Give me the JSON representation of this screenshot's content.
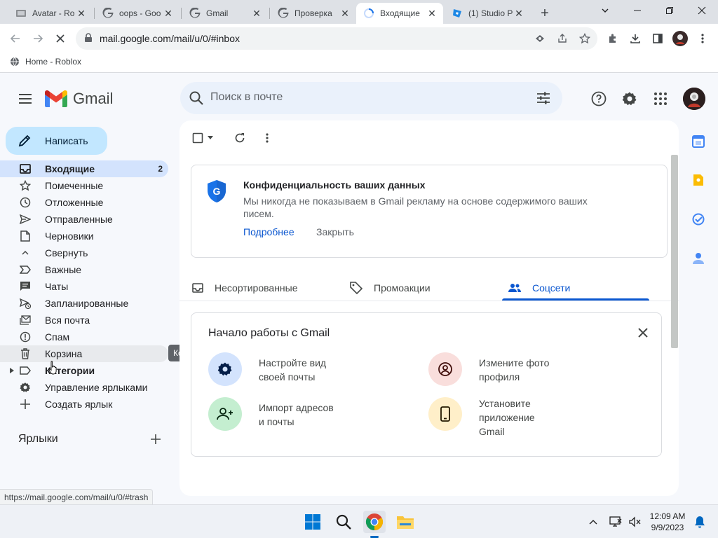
{
  "browser": {
    "tabs": [
      {
        "title": "Avatar - Ro",
        "icon": "roblox-page-icon",
        "active": false
      },
      {
        "title": "oops - Goo",
        "icon": "google-icon",
        "active": false
      },
      {
        "title": "Gmail",
        "icon": "google-icon",
        "active": false
      },
      {
        "title": "Проверка",
        "icon": "google-icon",
        "active": false
      },
      {
        "title": "Входящие",
        "icon": "loading-icon",
        "active": true
      },
      {
        "title": "(1) Studio P",
        "icon": "roblox-studio-icon",
        "active": false
      }
    ],
    "url": "mail.google.com/mail/u/0/#inbox",
    "bookmarks": [
      {
        "label": "Home - Roblox"
      }
    ],
    "status_url": "https://mail.google.com/mail/u/0/#trash"
  },
  "gmail": {
    "logo_text": "Gmail",
    "search_placeholder": "Поиск в почте",
    "compose_label": "Написать",
    "nav": [
      {
        "label": "Входящие",
        "icon": "inbox-icon",
        "count": "2",
        "active": true
      },
      {
        "label": "Помеченные",
        "icon": "star-icon"
      },
      {
        "label": "Отложенные",
        "icon": "clock-icon"
      },
      {
        "label": "Отправленные",
        "icon": "send-icon"
      },
      {
        "label": "Черновики",
        "icon": "draft-icon"
      },
      {
        "label": "Свернуть",
        "icon": "chevron-up-icon"
      },
      {
        "label": "Важные",
        "icon": "important-icon"
      },
      {
        "label": "Чаты",
        "icon": "chat-icon"
      },
      {
        "label": "Запланированные",
        "icon": "scheduled-send-icon"
      },
      {
        "label": "Вся почта",
        "icon": "all-mail-icon"
      },
      {
        "label": "Спам",
        "icon": "spam-icon"
      },
      {
        "label": "Корзина",
        "icon": "trash-icon",
        "hover": true
      },
      {
        "label": "Категории",
        "icon": "label-icon",
        "bold": true
      },
      {
        "label": "Управление ярлыками",
        "icon": "gear-icon"
      },
      {
        "label": "Создать ярлык",
        "icon": "plus-icon"
      }
    ],
    "tooltip": "Корзина",
    "labels_heading": "Ярлыки",
    "privacy_card": {
      "title": "Конфиденциальность ваших данных",
      "text": "Мы никогда не показываем в Gmail рекламу на основе содержимого ваших писем.",
      "learn_more": "Подробнее",
      "close": "Закрыть"
    },
    "category_tabs": [
      {
        "label": "Несортированные",
        "icon": "inbox-icon",
        "active": false
      },
      {
        "label": "Промоакции",
        "icon": "tag-icon",
        "active": false
      },
      {
        "label": "Соцсети",
        "icon": "people-icon",
        "active": true
      }
    ],
    "getting_started": {
      "title": "Начало работы с Gmail",
      "items": [
        {
          "label": "Настройте вид\nсвоей почты",
          "icon": "settings-icon"
        },
        {
          "label": "Измените фото\nпрофиля",
          "icon": "profile-icon"
        },
        {
          "label": "Импорт адресов\nи почты",
          "icon": "import-contacts-icon"
        },
        {
          "label": "Установите\nприложение\nGmail",
          "icon": "phone-icon"
        }
      ]
    }
  },
  "taskbar": {
    "time": "12:09 AM",
    "date": "9/9/2023"
  },
  "colors": {
    "accent_blue": "#0b57d0",
    "compose_bg": "#c2e7ff",
    "active_nav_bg": "#d3e3fd",
    "search_bg": "#eaf1fb",
    "page_bg": "#f6f8fc"
  }
}
